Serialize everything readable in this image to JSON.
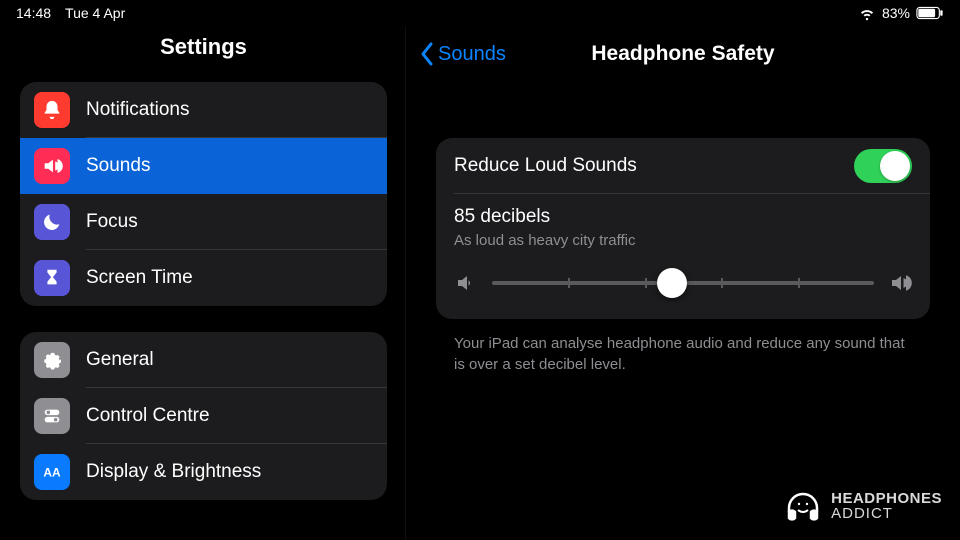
{
  "status": {
    "time": "14:48",
    "date": "Tue 4 Apr",
    "battery": "83%"
  },
  "sidebar": {
    "title": "Settings",
    "group1": [
      {
        "label": "Notifications",
        "icon": "bell",
        "color": "#ff3b30",
        "selected": false
      },
      {
        "label": "Sounds",
        "icon": "speaker",
        "color": "#ff2d55",
        "selected": true
      },
      {
        "label": "Focus",
        "icon": "moon",
        "color": "#5856d6",
        "selected": false
      },
      {
        "label": "Screen Time",
        "icon": "hourglass",
        "color": "#5856d6",
        "selected": false
      }
    ],
    "group2": [
      {
        "label": "General",
        "icon": "gear",
        "color": "#8e8e93",
        "selected": false
      },
      {
        "label": "Control Centre",
        "icon": "toggles",
        "color": "#8e8e93",
        "selected": false
      },
      {
        "label": "Display & Brightness",
        "icon": "aa",
        "color": "#0a7aff",
        "selected": false
      }
    ]
  },
  "detail": {
    "back_label": "Sounds",
    "title": "Headphone Safety",
    "reduce_label": "Reduce Loud Sounds",
    "reduce_on": true,
    "level_title": "85 decibels",
    "level_sub": "As loud as heavy city traffic",
    "slider_percent": 47,
    "footer": "Your iPad can analyse headphone audio and reduce any sound that is over a set decibel level."
  },
  "watermark": {
    "line1": "HEADPHONES",
    "line2": "ADDICT"
  }
}
